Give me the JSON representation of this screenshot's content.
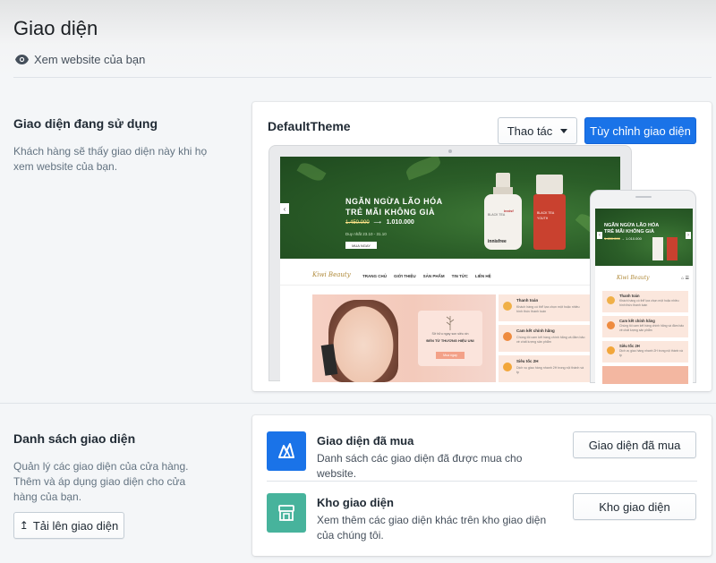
{
  "header": {
    "title": "Giao diện",
    "view_site_label": "Xem website của bạn"
  },
  "current_theme_section": {
    "title": "Giao diện đang sử dụng",
    "description": "Khách hàng sẽ thấy giao diện này khi họ xem website của bạn.",
    "theme_name": "DefaultTheme",
    "actions_label": "Thao tác",
    "customize_label": "Tùy chỉnh giao diện",
    "accent_color": "#1a73e8",
    "preview": {
      "banner_title_line1": "NGĂN NGỪA LÃO HÓA",
      "banner_title_line2": "TRẺ MÃI KHÔNG GIÀ",
      "old_price": "1.450.000",
      "new_price": "1.010.000",
      "date": "Duy nhất 23.10 - 31.10",
      "buy_button": "MUA NGAY",
      "brand_bottle": "innisfree",
      "bottle_text": "BLACK TEA YOUTH ENHANCING AMPOULE",
      "logo": "Kiwi Beauty",
      "nav": [
        "TRANG CHỦ",
        "GIỚI THIỆU",
        "SẢN PHẨM",
        "TIN TỨC",
        "LIÊN HỆ"
      ],
      "promo_small": "Sở hữu ngay son siêu xin",
      "promo_strong": "ĐẾN TỪ THƯƠNG HIỆU UNI",
      "promo_button": "Mua ngay",
      "features": [
        {
          "title": "Thanh toán",
          "desc": "Khách hàng có thể lựa chọn một hoặc nhiều hình thức thanh toán"
        },
        {
          "title": "Cam kết chính hãng",
          "desc": "Chúng tôi cam kết hàng chính hãng và đảm bảo về chất lượng sản phẩm"
        },
        {
          "title": "Siêu tốc 2H",
          "desc": "Dịch vụ giao hàng nhanh 2H trong nội thành và tp"
        }
      ]
    }
  },
  "theme_list_section": {
    "title": "Danh sách giao diện",
    "description": "Quản lý các giao diện của cửa hàng. Thêm và áp dụng giao diện cho cửa hàng của bạn.",
    "upload_label": "Tải lên giao diện",
    "purchased": {
      "title": "Giao diện đã mua",
      "description": "Danh sách các giao diện đã được mua cho website.",
      "button_label": "Giao diện đã mua",
      "icon": "theme-purchased-icon",
      "icon_color": "#1a73e8"
    },
    "store": {
      "title": "Kho giao diện",
      "description": "Xem thêm các giao diện khác trên kho giao diện của chúng tôi.",
      "button_label": "Kho giao diện",
      "icon": "store-icon",
      "icon_color": "#47b39c"
    }
  }
}
